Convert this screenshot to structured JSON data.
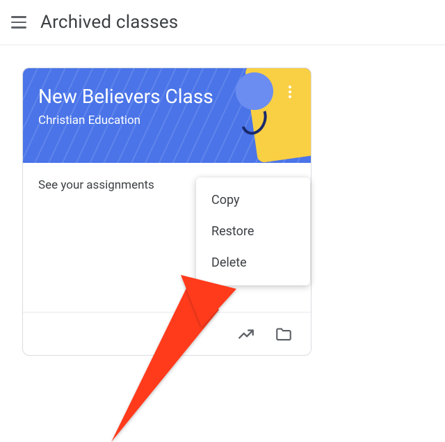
{
  "header": {
    "title": "Archived classes"
  },
  "card": {
    "title": "New Believers Class",
    "subtitle": "Christian Education",
    "assignments_text": "See your assignments"
  },
  "menu": {
    "items": [
      "Copy",
      "Restore",
      "Delete"
    ]
  }
}
